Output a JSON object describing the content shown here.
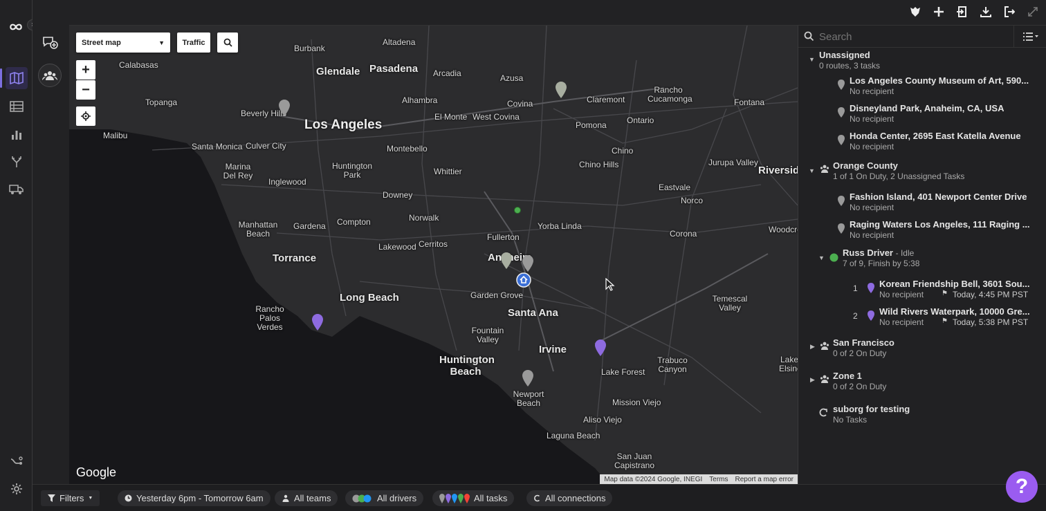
{
  "topbar": {
    "icons": [
      "badge-icon",
      "add-icon",
      "import-icon",
      "download-icon",
      "logout-icon",
      "expand-icon"
    ]
  },
  "leftnav": {
    "items": [
      {
        "name": "map-icon",
        "active": true
      },
      {
        "name": "list-icon",
        "active": false
      },
      {
        "name": "analytics-icon",
        "active": false
      },
      {
        "name": "routes-icon",
        "active": false
      },
      {
        "name": "truck-icon",
        "active": false
      }
    ],
    "bottom": [
      "integrations-icon",
      "settings-icon"
    ]
  },
  "map": {
    "type_select": "Street map",
    "traffic_label": "Traffic",
    "google_label": "Google",
    "attribution": {
      "data": "Map data ©2024 Google, INEGI",
      "terms": "Terms",
      "report": "Report a map error"
    },
    "labels": [
      {
        "text": "Altadena"
      },
      {
        "text": "Burbank"
      },
      {
        "text": "Glendale"
      },
      {
        "text": "Pasadena"
      },
      {
        "text": "Arcadia"
      },
      {
        "text": "Azusa"
      },
      {
        "text": "Calabasas"
      },
      {
        "text": "Topanga"
      },
      {
        "text": "Beverly Hills"
      },
      {
        "text": "Los Angeles"
      },
      {
        "text": "Alhambra"
      },
      {
        "text": "Covina"
      },
      {
        "text": "El Monte"
      },
      {
        "text": "West Covina"
      },
      {
        "text": "Claremont"
      },
      {
        "text": "Rancho Cucamonga"
      },
      {
        "text": "Fontana"
      },
      {
        "text": "Malibu"
      },
      {
        "text": "Santa Monica"
      },
      {
        "text": "Culver City"
      },
      {
        "text": "Montebello"
      },
      {
        "text": "Pomona"
      },
      {
        "text": "Ontario"
      },
      {
        "text": "Marina Del Rey"
      },
      {
        "text": "Huntington Park"
      },
      {
        "text": "Whittier"
      },
      {
        "text": "Chino"
      },
      {
        "text": "Chino Hills"
      },
      {
        "text": "Jurupa Valley"
      },
      {
        "text": "Riverside"
      },
      {
        "text": "Inglewood"
      },
      {
        "text": "Downey"
      },
      {
        "text": "Eastvale"
      },
      {
        "text": "Norco"
      },
      {
        "text": "Manhattan Beach"
      },
      {
        "text": "Gardena"
      },
      {
        "text": "Compton"
      },
      {
        "text": "Norwalk"
      },
      {
        "text": "Fullerton"
      },
      {
        "text": "Yorba Linda"
      },
      {
        "text": "Corona"
      },
      {
        "text": "Woodcrest"
      },
      {
        "text": "Lakewood"
      },
      {
        "text": "Cerritos"
      },
      {
        "text": "Torrance"
      },
      {
        "text": "Anaheim"
      },
      {
        "text": "Rancho Palos Verdes"
      },
      {
        "text": "Long Beach"
      },
      {
        "text": "Garden Grove"
      },
      {
        "text": "Santa Ana"
      },
      {
        "text": "Temescal Valley"
      },
      {
        "text": "Fountain Valley"
      },
      {
        "text": "Irvine"
      },
      {
        "text": "Huntington Beach"
      },
      {
        "text": "Trabuco Canyon"
      },
      {
        "text": "Lake Forest"
      },
      {
        "text": "Lake Elsinore"
      },
      {
        "text": "Newport Beach"
      },
      {
        "text": "Mission Viejo"
      },
      {
        "text": "Aliso Viejo"
      },
      {
        "text": "Laguna Beach"
      },
      {
        "text": "San Juan Capistrano"
      }
    ]
  },
  "panel": {
    "search_placeholder": "Search",
    "groups": [
      {
        "title": "Unassigned",
        "subtitle": "0 routes, 3 tasks",
        "tasks": [
          {
            "title": "Los Angeles County Museum of Art, 590...",
            "recipient": "No recipient"
          },
          {
            "title": "Disneyland Park, Anaheim, CA, USA",
            "recipient": "No recipient"
          },
          {
            "title": "Honda Center, 2695 East Katella Avenue",
            "recipient": "No recipient"
          }
        ]
      },
      {
        "title": "Orange County",
        "subtitle": "1 of 1 On Duty, 2 Unassigned Tasks",
        "tasks": [
          {
            "title": "Fashion Island, 401 Newport Center Drive",
            "recipient": "No recipient"
          },
          {
            "title": "Raging Waters Los Angeles, 111 Raging ...",
            "recipient": "No recipient"
          }
        ],
        "driver": {
          "name": "Russ Driver",
          "status": "- Idle",
          "summary": "7 of 9, Finish by 5:38",
          "tasks": [
            {
              "index": "1",
              "title": "Korean Friendship Bell, 3601 Sou...",
              "recipient": "No recipient",
              "eta": "Today, 4:45 PM PST"
            },
            {
              "index": "2",
              "title": "Wild Rivers Waterpark, 10000 Gre...",
              "recipient": "No recipient",
              "eta": "Today, 5:38 PM PST"
            }
          ]
        }
      },
      {
        "title": "San Francisco",
        "subtitle": "0 of 2 On Duty"
      },
      {
        "title": "Zone 1",
        "subtitle": "0 of 2 On Duty"
      },
      {
        "title": "suborg for testing",
        "subtitle": "No Tasks"
      }
    ]
  },
  "bottombar": {
    "filters": "Filters",
    "time_range": "Yesterday 6pm - Tomorrow 6am",
    "teams": "All teams",
    "drivers": "All drivers",
    "tasks": "All tasks",
    "connections": "All connections"
  },
  "help_label": "?",
  "colors": {
    "accent": "#7c6fe0",
    "pin_purple": "#8e6be0",
    "pin_gray": "#9a9a9a",
    "driver_green": "#4caf50",
    "help": "#9a5cf0"
  }
}
